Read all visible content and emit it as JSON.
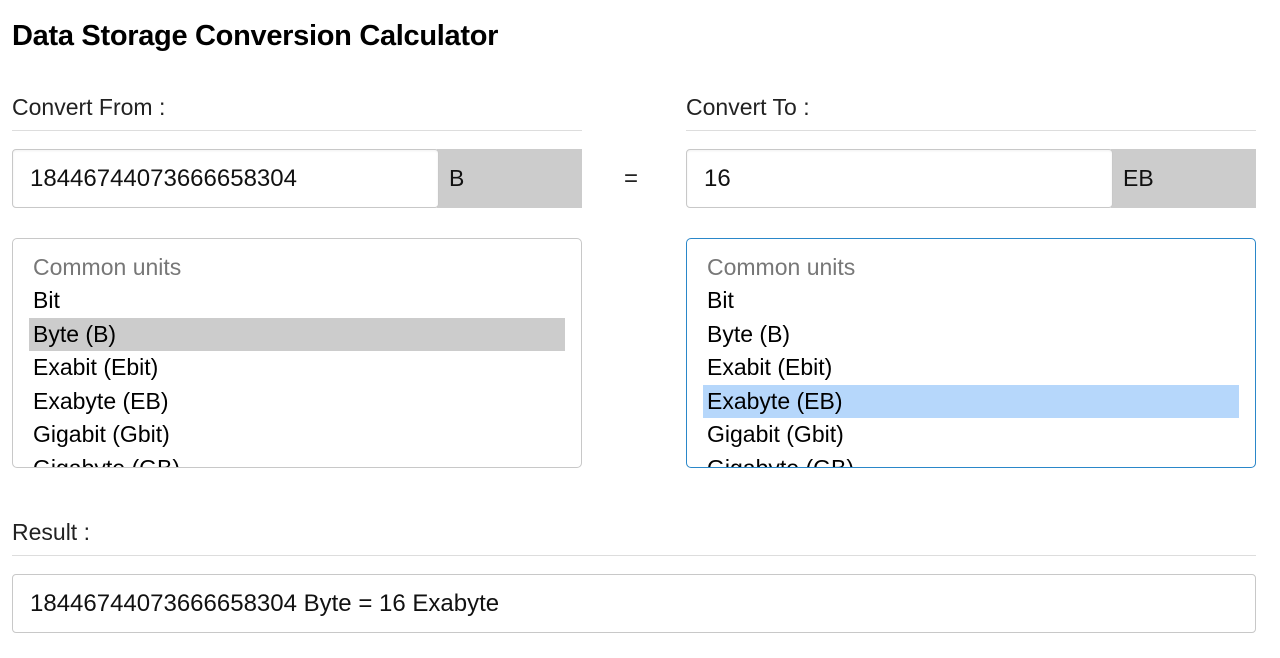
{
  "title": "Data Storage Conversion Calculator",
  "from": {
    "label": "Convert From :",
    "value": "18446744073666658304",
    "unit": "B",
    "list": {
      "group_label": "Common units",
      "options": [
        "Bit",
        "Byte (B)",
        "Exabit (Ebit)",
        "Exabyte (EB)",
        "Gigabit (Gbit)",
        "Gigabyte (GB)"
      ],
      "selected": "Byte (B)"
    }
  },
  "equals": "=",
  "to": {
    "label": "Convert To :",
    "value": "16",
    "unit": "EB",
    "list": {
      "group_label": "Common units",
      "options": [
        "Bit",
        "Byte (B)",
        "Exabit (Ebit)",
        "Exabyte (EB)",
        "Gigabit (Gbit)",
        "Gigabyte (GB)"
      ],
      "selected": "Exabyte (EB)"
    }
  },
  "result": {
    "label": "Result :",
    "text": "18446744073666658304 Byte = 16 Exabyte"
  },
  "colors": {
    "addon_bg": "#cccccc",
    "selected_unfocused": "#cccccc",
    "selected_focused": "#b6d7fb",
    "focus_border": "#2a87c9"
  }
}
